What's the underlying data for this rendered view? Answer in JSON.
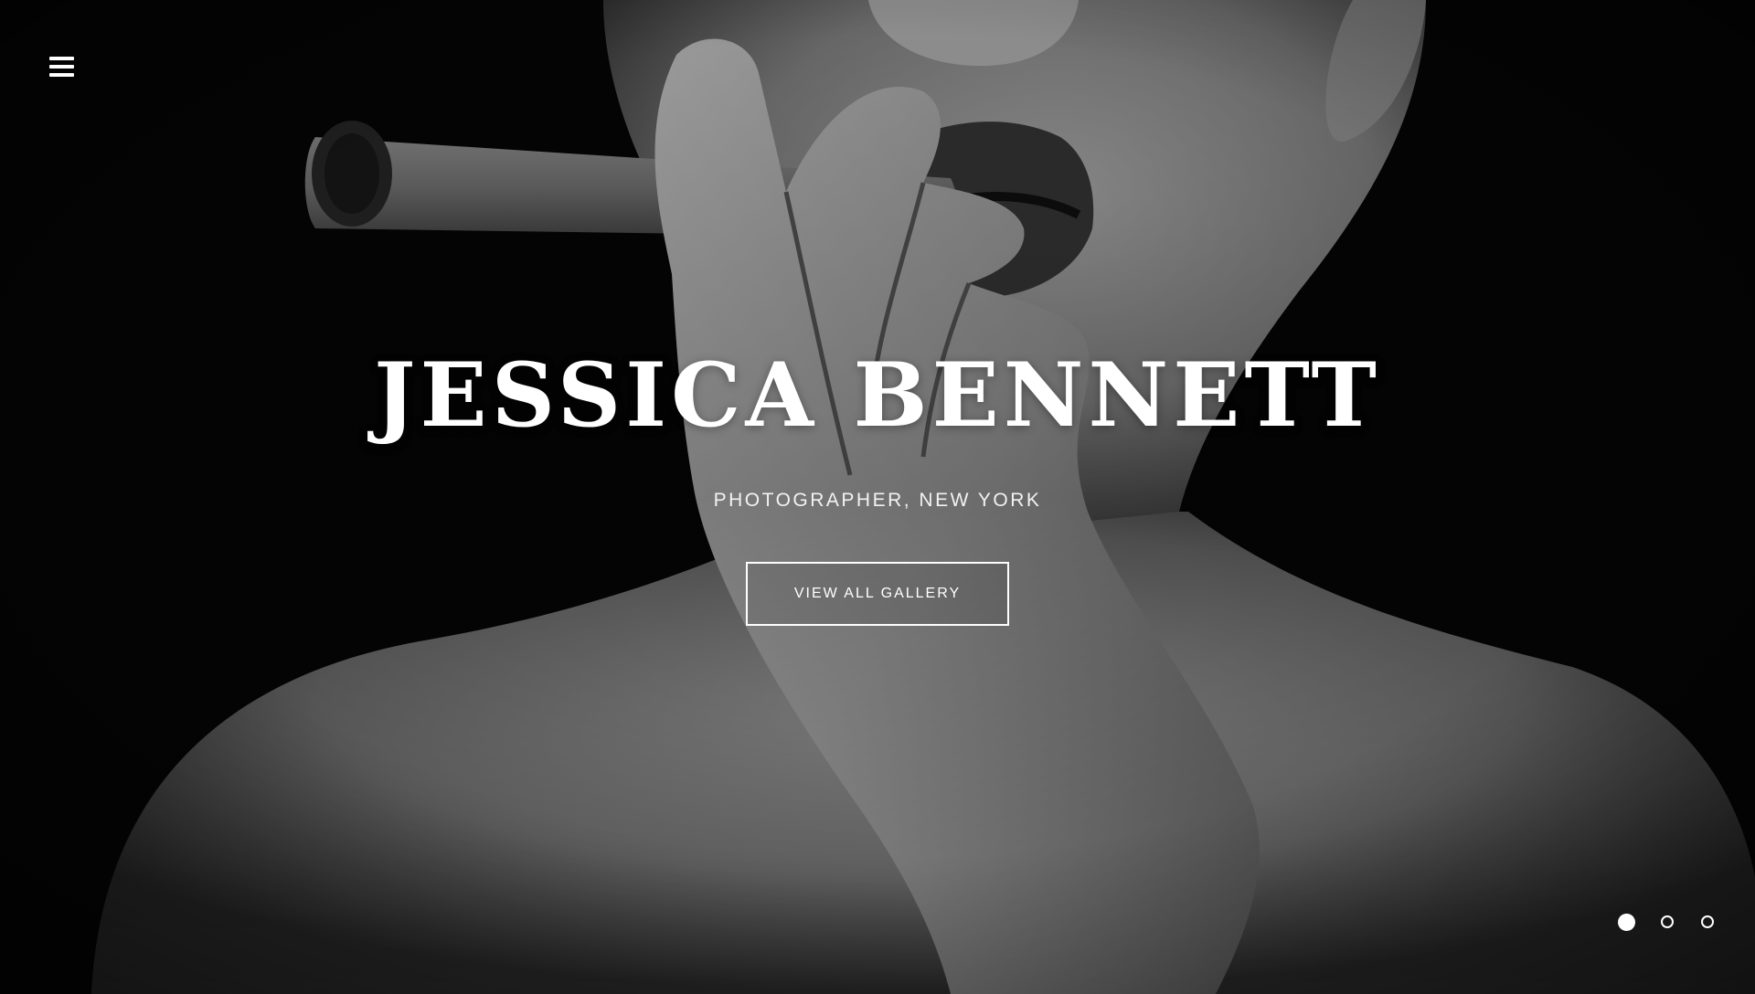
{
  "hero": {
    "title": "JESSICA BENNETT",
    "subtitle": "PHOTOGRAPHER, NEW YORK",
    "cta_label": "VIEW ALL GALLERY",
    "image_icon": "portrait-photo-icon"
  },
  "nav": {
    "menu_icon": "hamburger-menu-icon"
  },
  "slider": {
    "total_slides": 3,
    "active_slide": 1
  },
  "colors": {
    "background": "#050505",
    "text": "#ffffff",
    "skin_tone": "#8a8a8a"
  }
}
